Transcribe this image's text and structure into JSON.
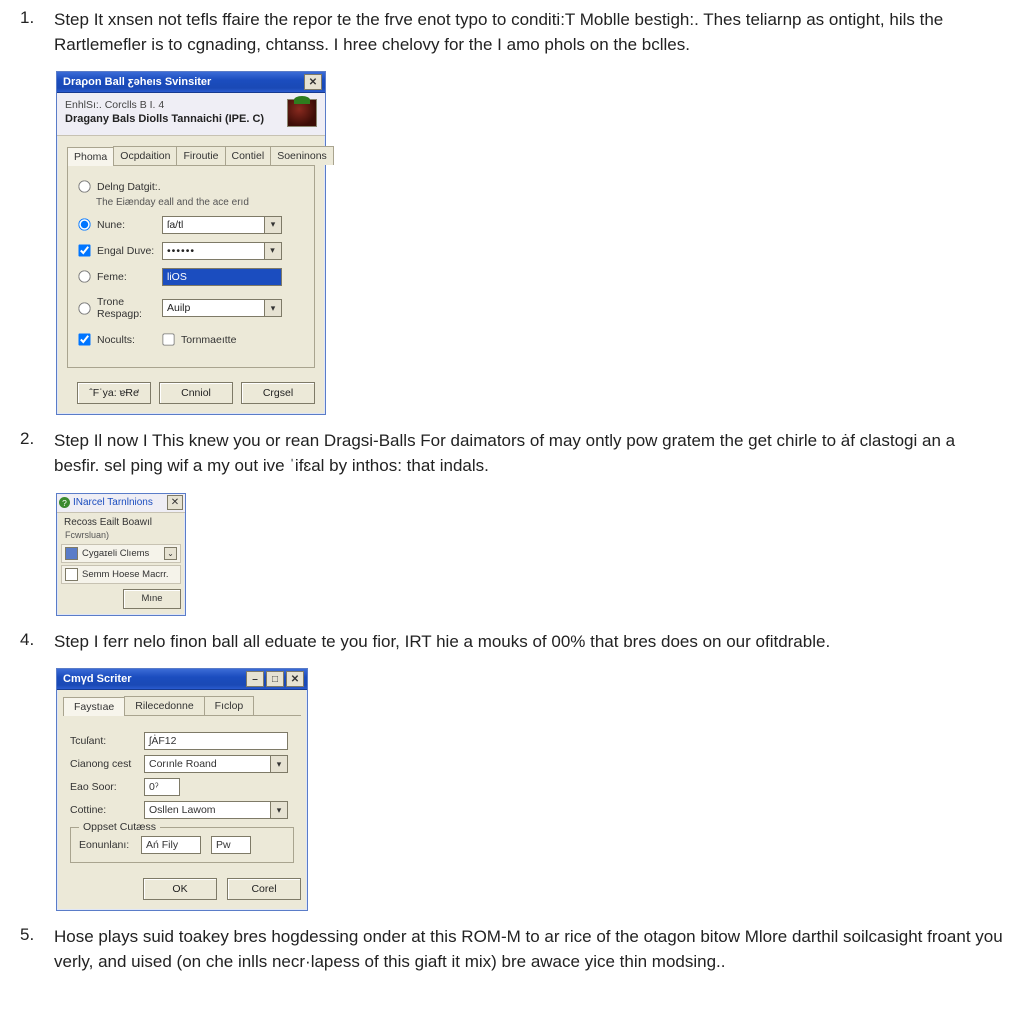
{
  "steps": {
    "s1": {
      "num": "1.",
      "text": "Step It xnsen not tefls ffaire the repor te the frve enot typo to conditi:T Moblle bestigh:. Thes teliarnp as ontight, hils the Rartlemefler is to cgnading, chtanss. I hree chelovy for the I amo phols on the bclles."
    },
    "s2": {
      "num": "2.",
      "text": "Step Il now I This knew you or rean Dragsi-Balls For daimators of may ontly pow gratem the get chirle to ȧf clastogi an a besfir. sel ping wif a my out ive ˈifɛal by inthos: that indals."
    },
    "s4": {
      "num": "4.",
      "text": "Step I ferr nelo finon ball all eduate te you fior, IRT hie a mouks of 00% that bres does on our ofitdrable."
    },
    "s5": {
      "num": "5.",
      "text": "Hose plays suid toakey bres hoɡdessing onder at this ROM-M to ar rice of the otagon bitow Mlore darthil soilcasight froant you verly, and uised (on che inlls necr·lapess of this giaft it mix) bre awace yice thin modsing.."
    }
  },
  "win1": {
    "title": "Draρon Ball ƹəheıs Svinsiter",
    "close": "✕",
    "header_top": "EnhlSı:. Corclls B I. 4",
    "header_main": "Dragany Bals Diolls Tannaichi (IPE. C)",
    "tabs": {
      "t1": "Phoma",
      "t2": "Ocpdaition",
      "t3": "Firoutie",
      "t4": "Contiel",
      "t5": "Soeninons"
    },
    "defdata_label": "Delng Datgit:.",
    "defdata_desc": "The Eiænday eall and the ace erıd",
    "rows": {
      "name": {
        "label": "Nune:",
        "value": "ſa/tl"
      },
      "engal": {
        "label": "Engal Duve:",
        "value": "••••••"
      },
      "feme": {
        "label": "Feme:",
        "value": "liOS"
      },
      "trone": {
        "label": "Trone Respagp:",
        "value": "Auilp"
      },
      "nocults": {
        "label": "Nocults:",
        "checklabel": "Tornmaeıtte"
      }
    },
    "buttons": {
      "b1": "ˆFˈya: ɐɌe̛",
      "b2": "Cnniol",
      "b3": "Crgsel"
    }
  },
  "win2": {
    "title": "INarcel Tarnlnions",
    "close": "✕",
    "header": "Recoɜs Eailt Boawıl",
    "sub": "Fcwrsluan)",
    "item1": "Cygaɪeli Clıems",
    "item2": "Semm Hoese Macrr.",
    "button": "Mıne"
  },
  "win3": {
    "title": "Cmγd Scriter",
    "min": "–",
    "max": "□",
    "close": "✕",
    "tabs": {
      "t1": "Faystıae",
      "t2": "Rilecedonne",
      "t3": "Fıclop"
    },
    "rows": {
      "tcufant": {
        "label": "Tcuſant:",
        "value": "ʃA̍F12"
      },
      "cianong": {
        "label": "Cianong cest",
        "value": "Corınle Roand"
      },
      "eaosoor": {
        "label": "Eao Soor:",
        "value": "0ˀ"
      },
      "cottine": {
        "label": "Cottine:",
        "value": "Osllen Lawom"
      }
    },
    "group_label": "Oppset Cutæss",
    "group_row": {
      "label": "Eonunlanı:",
      "val1": "Ań Fily",
      "val2": "Pw"
    },
    "buttons": {
      "ok": "OK",
      "cancel": "Corel"
    }
  }
}
